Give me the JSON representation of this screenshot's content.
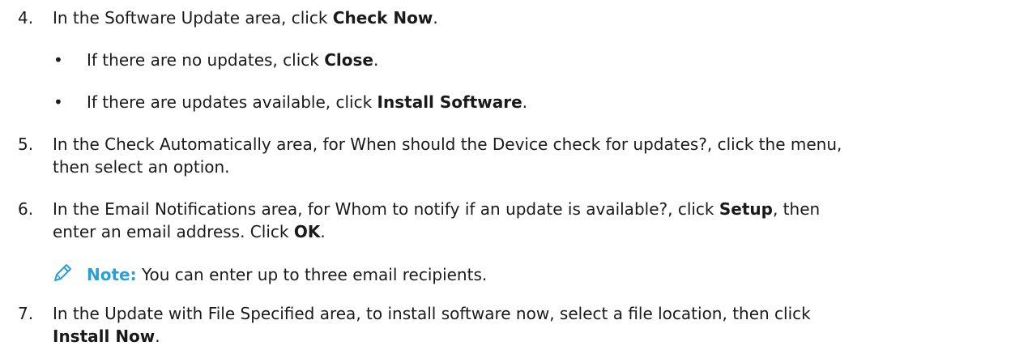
{
  "steps": [
    {
      "num": "4.",
      "pre": "In the Software Update area, click ",
      "bold": "Check Now",
      "post": "."
    },
    {
      "num": "5.",
      "line1": "In the Check Automatically area, for When should the Device check for updates?, click the menu,",
      "line2": "then select an option."
    },
    {
      "num": "6.",
      "line1_pre": "In the Email Notifications area, for Whom to notify if an update is available?, click ",
      "line1_bold": "Setup",
      "line1_post": ", then",
      "line2_pre": "enter an email address. Click ",
      "line2_bold": "OK",
      "line2_post": "."
    },
    {
      "num": "7.",
      "line1": "In the Update with File Specified area, to install software now, select a file location, then click",
      "line2_bold": "Install Now",
      "line2_post": "."
    }
  ],
  "bullets": [
    {
      "dot": "•",
      "pre": "If there are no updates, click ",
      "bold": "Close",
      "post": "."
    },
    {
      "dot": "•",
      "pre": "If there are updates available, click ",
      "bold": "Install Software",
      "post": "."
    }
  ],
  "note": {
    "icon": "pencil-icon",
    "label": "Note:",
    "text": " You can enter up to three email recipients."
  },
  "colors": {
    "note_accent": "#2a9fd6",
    "text": "#1a1a1a"
  }
}
